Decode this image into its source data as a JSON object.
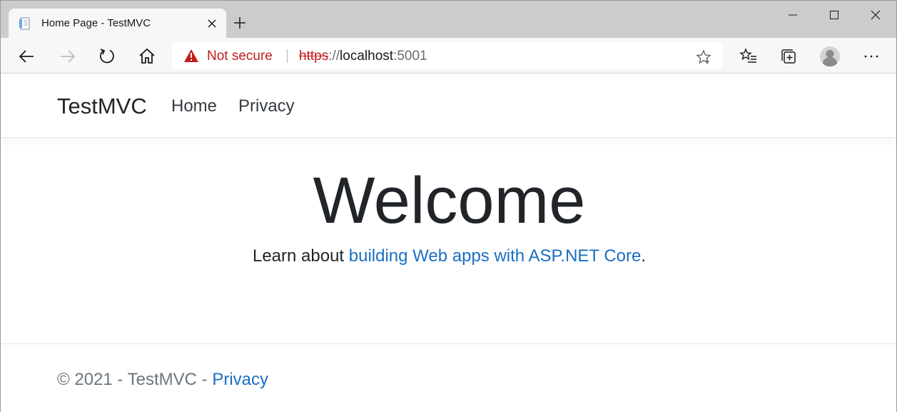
{
  "browser": {
    "tab": {
      "title": "Home Page - TestMVC"
    },
    "address_bar": {
      "security_label": "Not secure",
      "url_scheme": "https",
      "url_separator": "://",
      "url_host": "localhost",
      "url_port": ":5001"
    },
    "colors": {
      "tab_strip": "#cccccc",
      "toolbar": "#f7f7f7",
      "insecure_red": "#c41d1d"
    }
  },
  "site": {
    "brand": "TestMVC",
    "nav": [
      {
        "label": "Home"
      },
      {
        "label": "Privacy"
      }
    ],
    "main": {
      "title": "Welcome",
      "lead_prefix": "Learn about ",
      "lead_link": "building Web apps with ASP.NET Core",
      "lead_suffix": "."
    },
    "footer": {
      "copyright": "© 2021 - TestMVC - ",
      "privacy_link": "Privacy"
    },
    "colors": {
      "link": "#1b6ec2",
      "text": "#212529",
      "muted": "#6c757d"
    }
  }
}
